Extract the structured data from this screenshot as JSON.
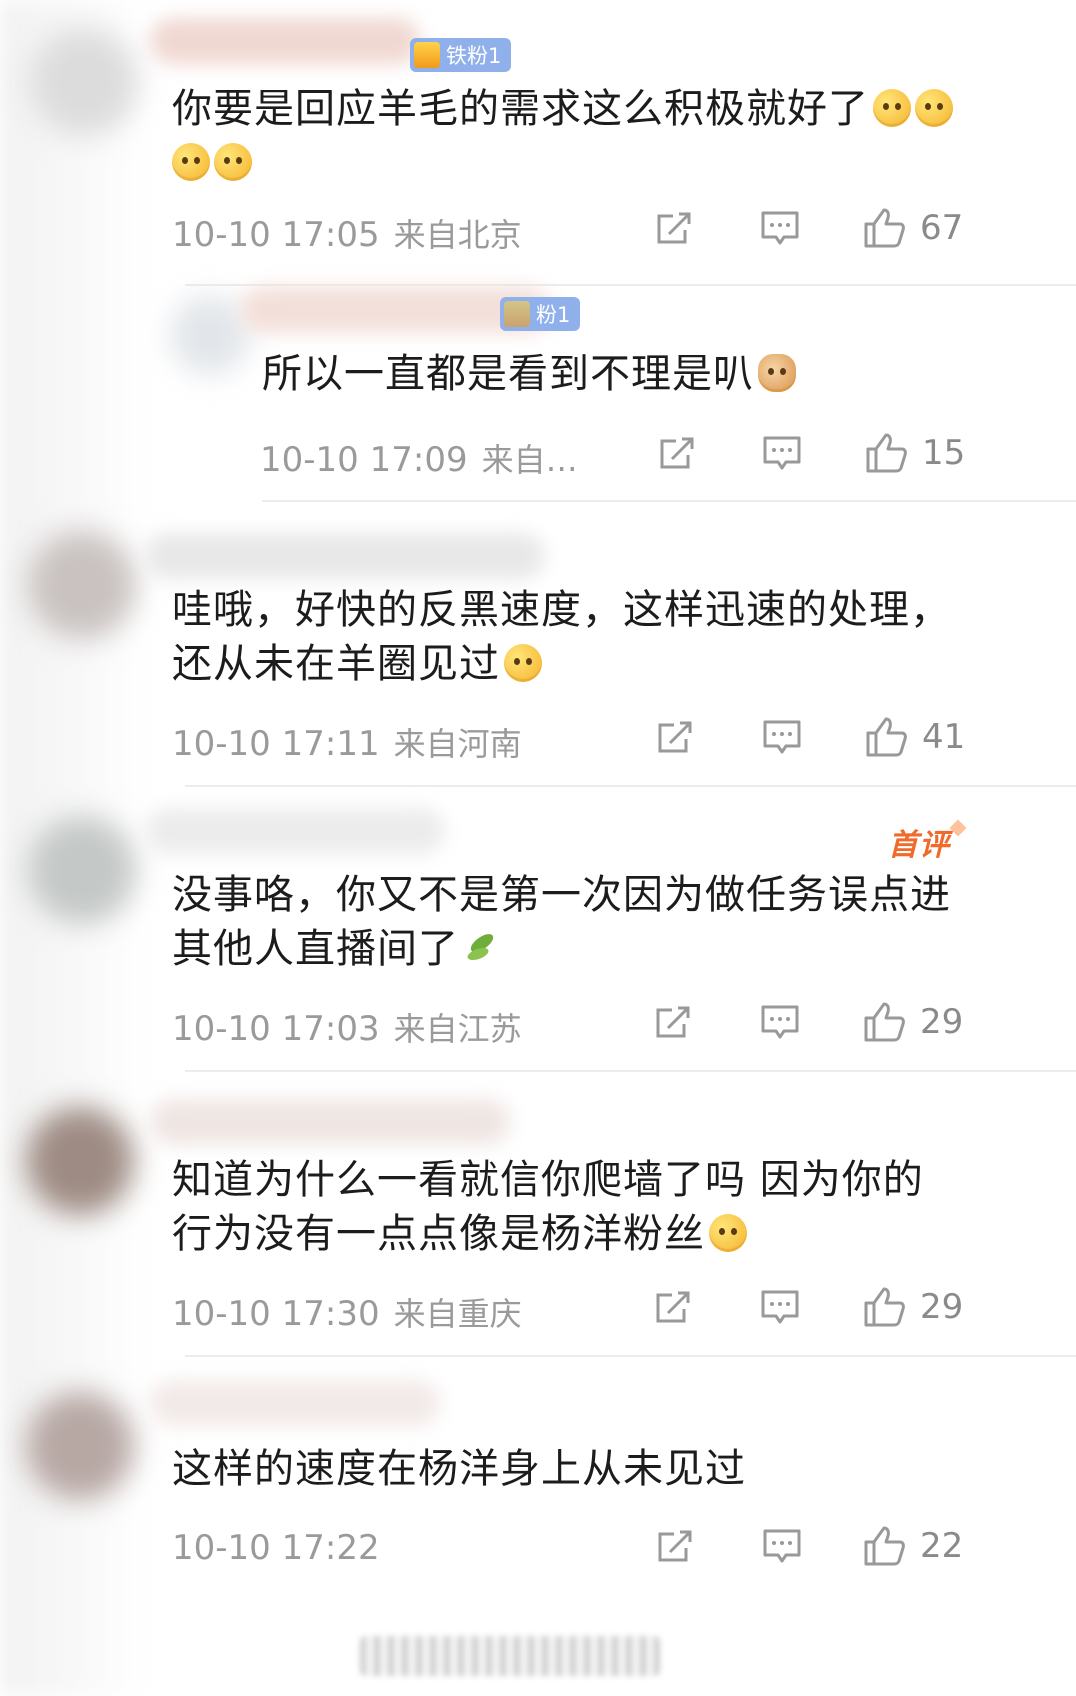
{
  "comments": [
    {
      "badge": "铁粉1",
      "text_lines": [
        "你要是回应羊毛的需求这么积极就好了",
        ""
      ],
      "time": "10-10 17:05",
      "location": "来自北京",
      "likes": "67"
    },
    {
      "badge": "粉1",
      "text_lines": [
        "所以一直都是看到不理是叭"
      ],
      "time": "10-10 17:09",
      "location": "来自…",
      "likes": "15"
    },
    {
      "text_lines": [
        "哇哦，好快的反黑速度，这样迅速的处理，",
        "还从未在羊圈见过"
      ],
      "time": "10-10 17:11",
      "location": "来自河南",
      "likes": "41"
    },
    {
      "tag": "首评",
      "text_lines": [
        "没事咯，你又不是第一次因为做任务误点进",
        "其他人直播间了"
      ],
      "time": "10-10 17:03",
      "location": "来自江苏",
      "likes": "29"
    },
    {
      "text_lines": [
        "知道为什么一看就信你爬墙了吗 因为你的",
        "行为没有一点点像是杨洋粉丝"
      ],
      "time": "10-10 17:30",
      "location": "来自重庆",
      "likes": "29"
    },
    {
      "text_lines": [
        "这样的速度在杨洋身上从未见过"
      ],
      "time": "10-10 17:22",
      "location": "",
      "likes": "22"
    }
  ],
  "colors": {
    "text": "#1c1c1c",
    "meta": "#9a9a9a",
    "badge_bg": "#8fb0ea",
    "first_tag": "#f06a2c",
    "divider": "#ececec"
  },
  "icons": {
    "repost": "repost-icon",
    "comment": "comment-icon",
    "like": "like-icon"
  }
}
